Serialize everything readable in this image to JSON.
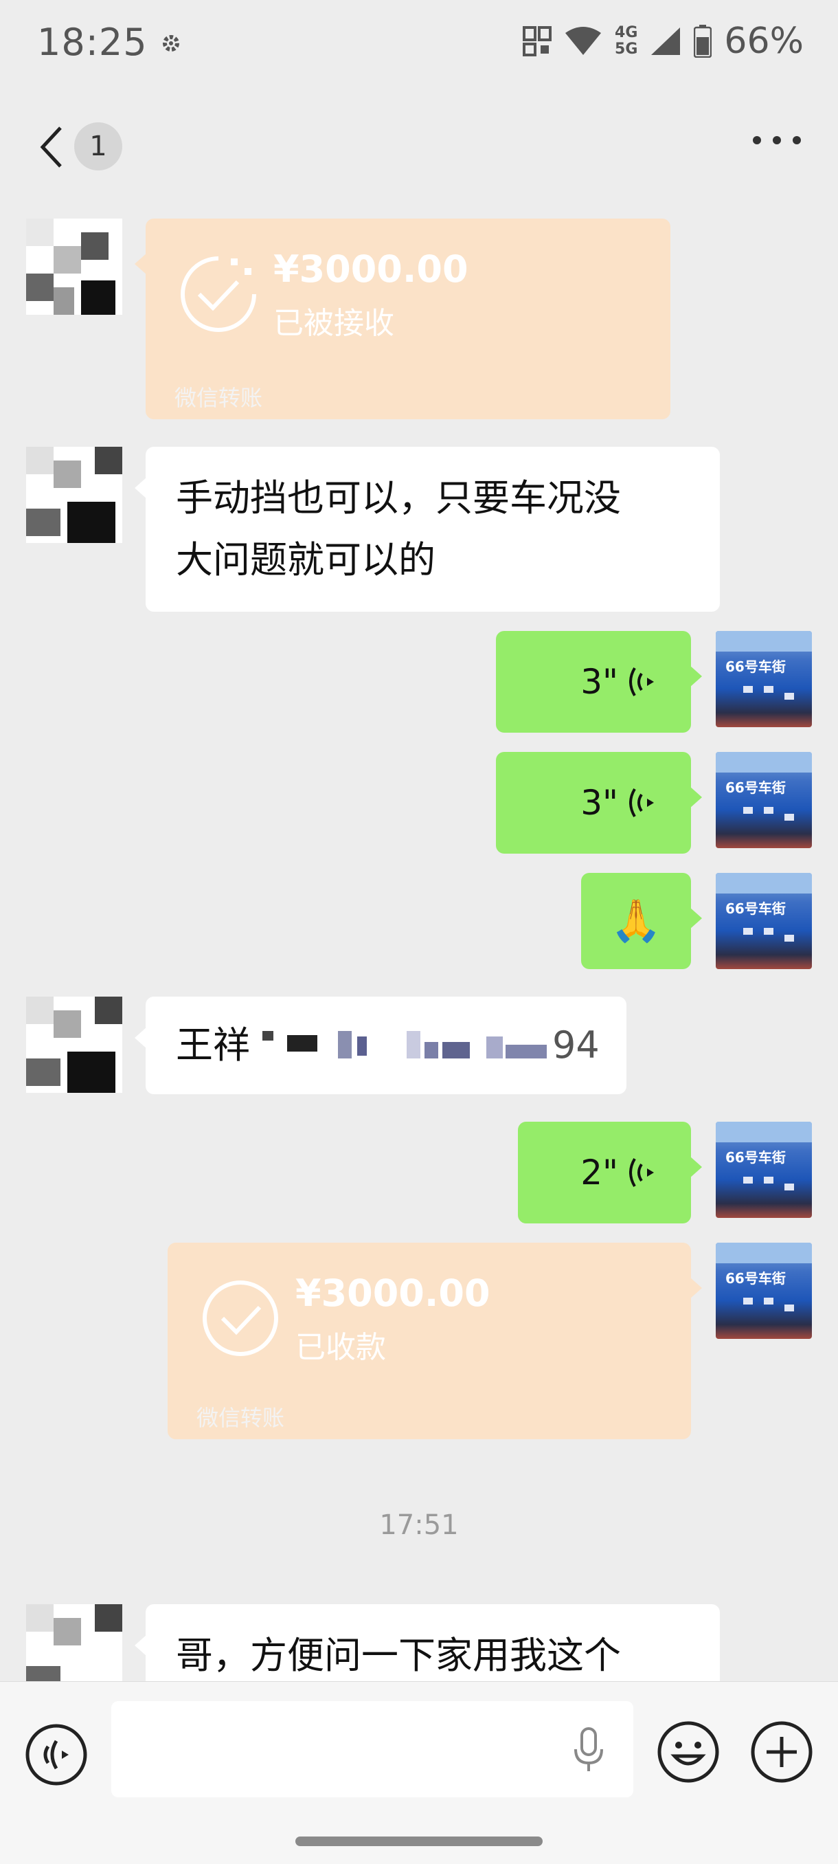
{
  "status_bar": {
    "time": "18:25",
    "net_top": "4G",
    "net_bottom": "5G",
    "battery": "66%"
  },
  "header": {
    "unread_badge": "1"
  },
  "messages": {
    "transfer_received": {
      "amount": "¥3000.00",
      "status": "已被接收",
      "footer": "微信转账"
    },
    "text_1": {
      "line1": "手动挡也可以，只要车况没",
      "line2": "大问题就可以的"
    },
    "voice_1": {
      "duration": "3\""
    },
    "voice_2": {
      "duration": "3\""
    },
    "emoji_1": {
      "glyph": "🙏"
    },
    "text_2": {
      "visible_start": "王祥",
      "visible_end": "94"
    },
    "voice_3": {
      "duration": "2\""
    },
    "transfer_sent": {
      "amount": "¥3000.00",
      "status": "已收款",
      "footer": "微信转账"
    },
    "timestamp": "17:51",
    "text_3": {
      "line1": "哥，方便问一下家用我这个"
    }
  },
  "avatar_sign": "66号车街",
  "colors": {
    "background": "#ededed",
    "green_bubble": "#95ec69",
    "white_bubble": "#ffffff",
    "transfer_card": "#fbe2c8"
  },
  "icons": {
    "back": "chevron-left-icon",
    "more": "more-dots-icon",
    "voice_toggle": "voice-toggle-icon",
    "mic": "mic-icon",
    "emoji": "emoji-icon",
    "plus": "plus-icon"
  }
}
